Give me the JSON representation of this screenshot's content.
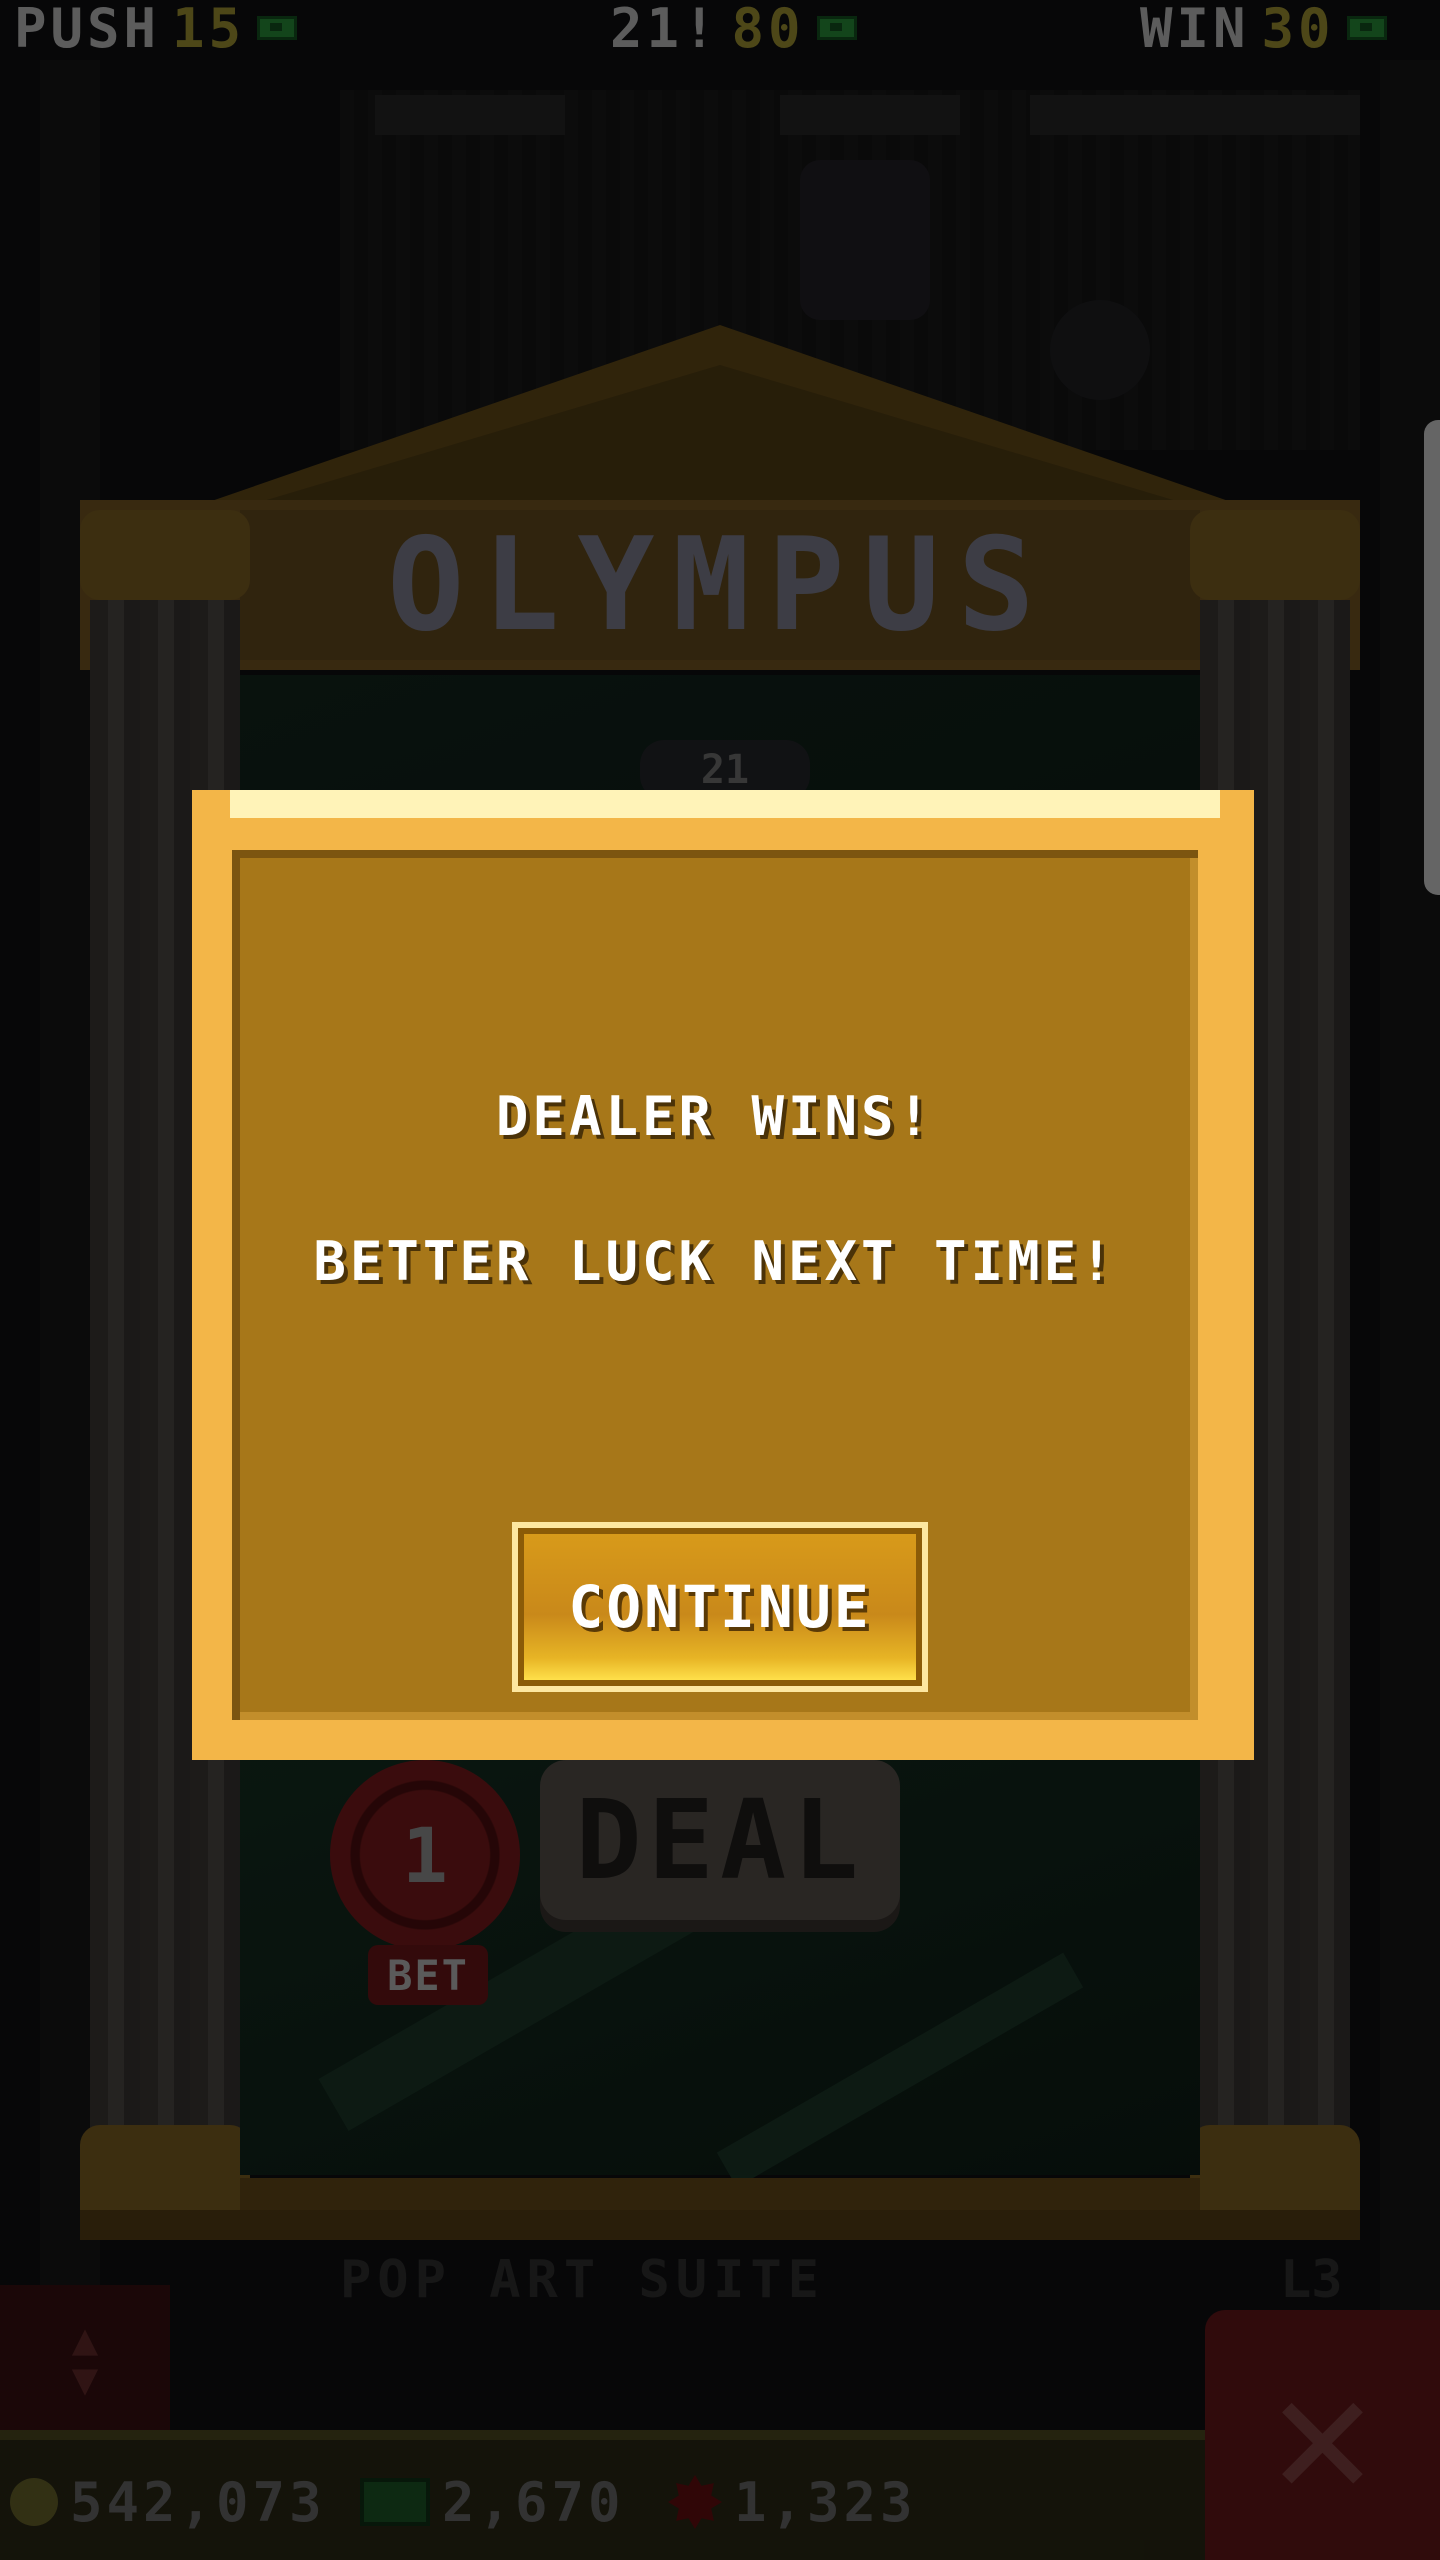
{
  "top_stats": {
    "push": {
      "label": "PUSH",
      "value": "15"
    },
    "blackjack": {
      "label": "21!",
      "value": "80"
    },
    "win": {
      "label": "WIN",
      "value": "30"
    }
  },
  "scene": {
    "temple_title": "OLYMPUS",
    "score_pill": "21",
    "chip_value": "1",
    "bet_label": "BET",
    "deal_label": "DEAL",
    "floor_name": "POP ART SUITE",
    "floor_number": "L3"
  },
  "dialog": {
    "line1": "DEALER WINS!",
    "line2": "BETTER LUCK NEXT TIME!",
    "continue_label": "CONTINUE"
  },
  "currency": {
    "coins": "542,073",
    "bucks": "2,670",
    "gems": "1,323"
  },
  "icons": {
    "close": "close-icon",
    "elevator": "elevator-arrows-icon"
  },
  "colors": {
    "dialog_border": "#f3b648",
    "dialog_fill": "#a77719",
    "stat_value": "#776e25"
  }
}
